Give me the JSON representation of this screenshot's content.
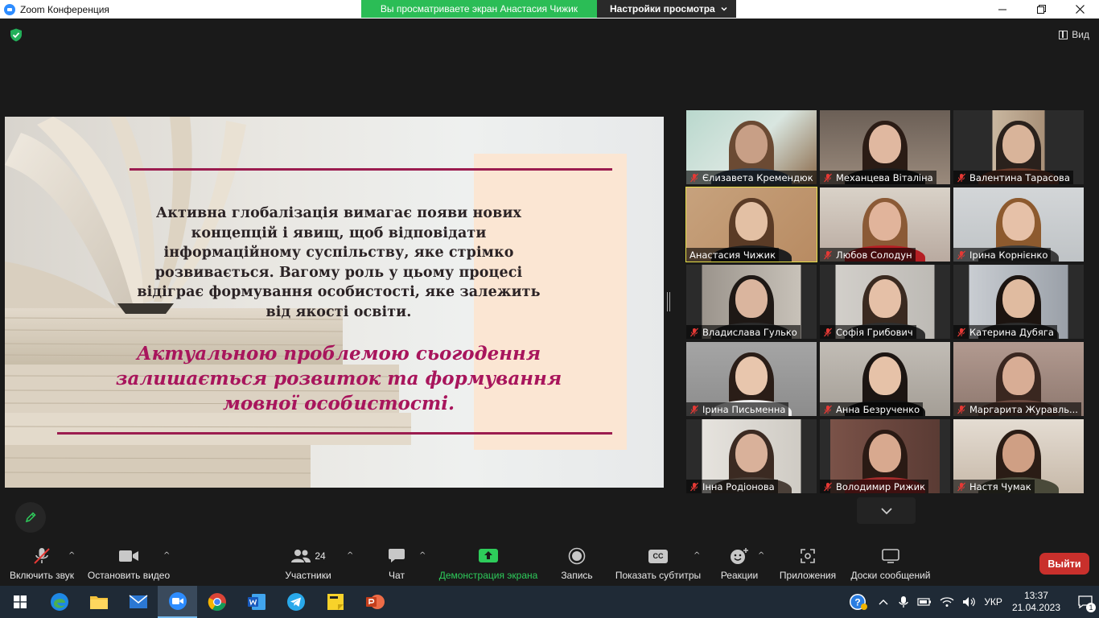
{
  "window": {
    "title": "Zoom Конференция"
  },
  "share_banner": {
    "status": "Вы просматриваете экран Анастасия Чижик",
    "view_options": "Настройки просмотра"
  },
  "view_toggle": {
    "label": "Вид"
  },
  "slide": {
    "paragraph": "Активна глобалізація вимагає появи нових концепцій і явищ, щоб відповідати інформаційному суспільству, яке стрімко розвивається. Вагому роль у цьому процесі відіграє формування особистості, яке залежить від якості освіти.",
    "quote": "Актуальною проблемою сьогодення залишається розвиток та формування мовної особистості."
  },
  "participants": [
    {
      "name": "Єлизавета Кремендюк",
      "muted": true
    },
    {
      "name": "Механцева Віталіна",
      "muted": true
    },
    {
      "name": "Валентина Тарасова",
      "muted": true
    },
    {
      "name": "Анастасия Чижик",
      "muted": false,
      "active": true
    },
    {
      "name": "Любов Солодун",
      "muted": true
    },
    {
      "name": "Ірина Корнієнко",
      "muted": true
    },
    {
      "name": "Владислава Гулько",
      "muted": true
    },
    {
      "name": "Софія Грибович",
      "muted": true
    },
    {
      "name": "Катерина Дубяга",
      "muted": true
    },
    {
      "name": "Ірина Письменна",
      "muted": true
    },
    {
      "name": "Анна Безрученко",
      "muted": true
    },
    {
      "name": "Маргарита Журавль...",
      "muted": true
    },
    {
      "name": "Інна Родіонова",
      "muted": true
    },
    {
      "name": "Володимир Рижик",
      "muted": true
    },
    {
      "name": "Настя Чумак",
      "muted": true
    }
  ],
  "toolbar": {
    "unmute": "Включить звук",
    "stop_video": "Остановить видео",
    "participants": "Участники",
    "participants_count": "24",
    "chat": "Чат",
    "share_screen": "Демонстрация экрана",
    "record": "Запись",
    "captions": "Показать субтитры",
    "captions_icon_text": "CC",
    "reactions": "Реакции",
    "apps": "Приложения",
    "whiteboards": "Доски сообщений",
    "leave": "Выйти"
  },
  "taskbar": {
    "apps": [
      "windows-start",
      "edge",
      "file-explorer",
      "mail",
      "zoom",
      "chrome",
      "word",
      "telegram",
      "sticky-notes",
      "powerpoint"
    ],
    "language": "УКР",
    "time": "13:37",
    "date": "21.04.2023",
    "notifications": "1"
  },
  "colors": {
    "share_green": "#2bbd56",
    "leave_red": "#c9302c",
    "slide_accent": "#9b1c4f",
    "quote_color": "#a8155c",
    "active_speaker": "#e6df47"
  }
}
